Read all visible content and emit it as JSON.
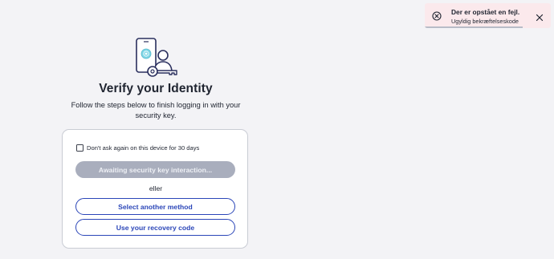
{
  "main": {
    "title": "Verify your Identity",
    "subtitle": "Follow the steps below to finish logging in with your security key."
  },
  "card": {
    "remember_label": "Don't ask again on this device for 30 days",
    "remember_checked": false,
    "awaiting_label": "Awaiting security key interaction...",
    "or_label": "eller",
    "select_method_label": "Select another method",
    "recovery_label": "Use your recovery code"
  },
  "toast": {
    "title": "Der er opstået en fejl.",
    "message": "Ugyldig bekræftelseskode",
    "progress": 0.78
  },
  "icons": {
    "illustration": "phone-user-key-icon",
    "toast_error": "error-circle-icon",
    "toast_close": "close-icon"
  },
  "colors": {
    "primary": "#2b46b8",
    "disabled_button": "#a9aebd",
    "toast_background": "#fbe9ec",
    "page_background": "#f3f3f6"
  }
}
